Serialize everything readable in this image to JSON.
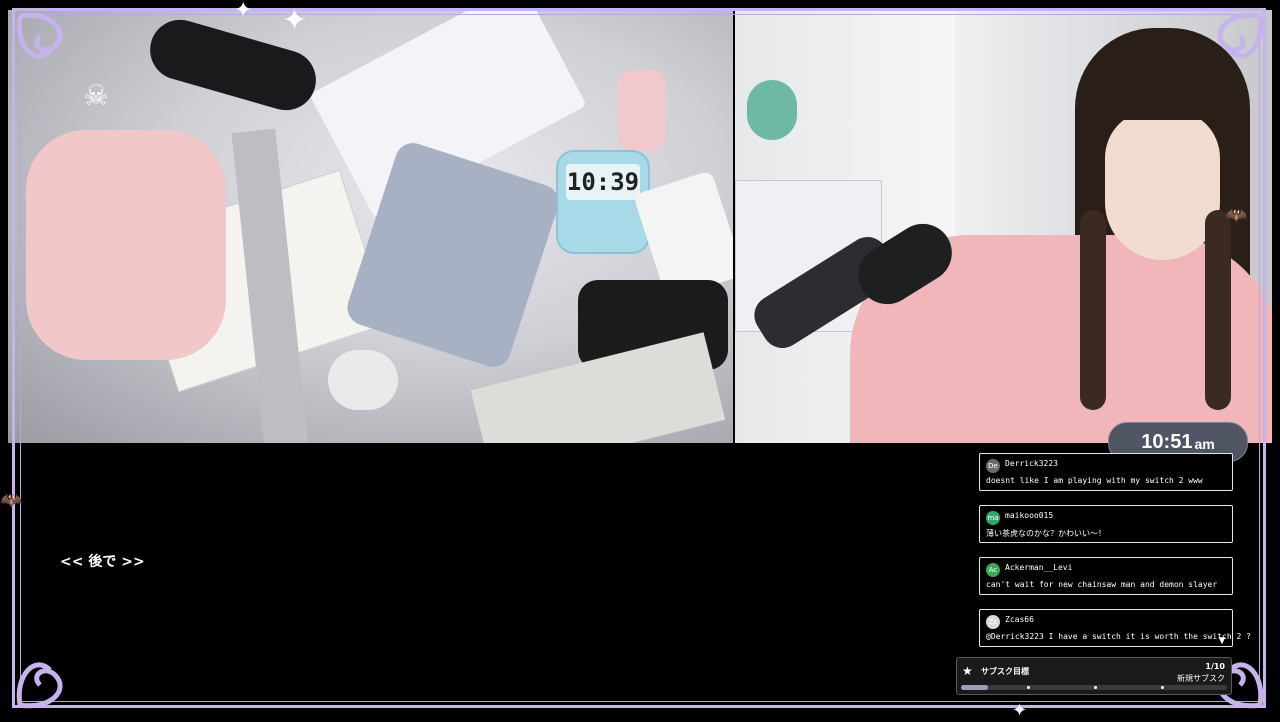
{
  "desk_cam": {
    "timer_display": "10:39"
  },
  "clock": {
    "time": "10:51",
    "ampm": "am"
  },
  "later_label": "<< 後で >>",
  "chat": {
    "messages": [
      {
        "avatar": "De",
        "avatar_color": "#6b6b6b",
        "user": "Derrick3223",
        "text": "doesnt like I am playing with my switch 2 www"
      },
      {
        "avatar": "ma",
        "avatar_color": "#2fa86a",
        "user": "maikooo015",
        "text": "薄い茶虎なのかな？かわいい～！"
      },
      {
        "avatar": "Ac",
        "avatar_color": "#3aa65a",
        "user": "Ackerman__Levi",
        "text": "can't wait for new chainsaw man and demon slayer"
      },
      {
        "avatar": "Zc",
        "avatar_color": "#d8d8d8",
        "user": "Zcas66",
        "text": "@Derrick3223 I have a switch it is worth the switch 2 ?"
      }
    ],
    "scroll_icon": "chevron-down-icon"
  },
  "subgoal": {
    "label": "サブスク目標",
    "count": "1/10",
    "sublabel": "新規サブスク",
    "progress": 0.1,
    "icon": "star-icon"
  },
  "colors": {
    "frame": "#c7b3ec",
    "clock_bg": "#4f5562",
    "background": "#000000"
  }
}
